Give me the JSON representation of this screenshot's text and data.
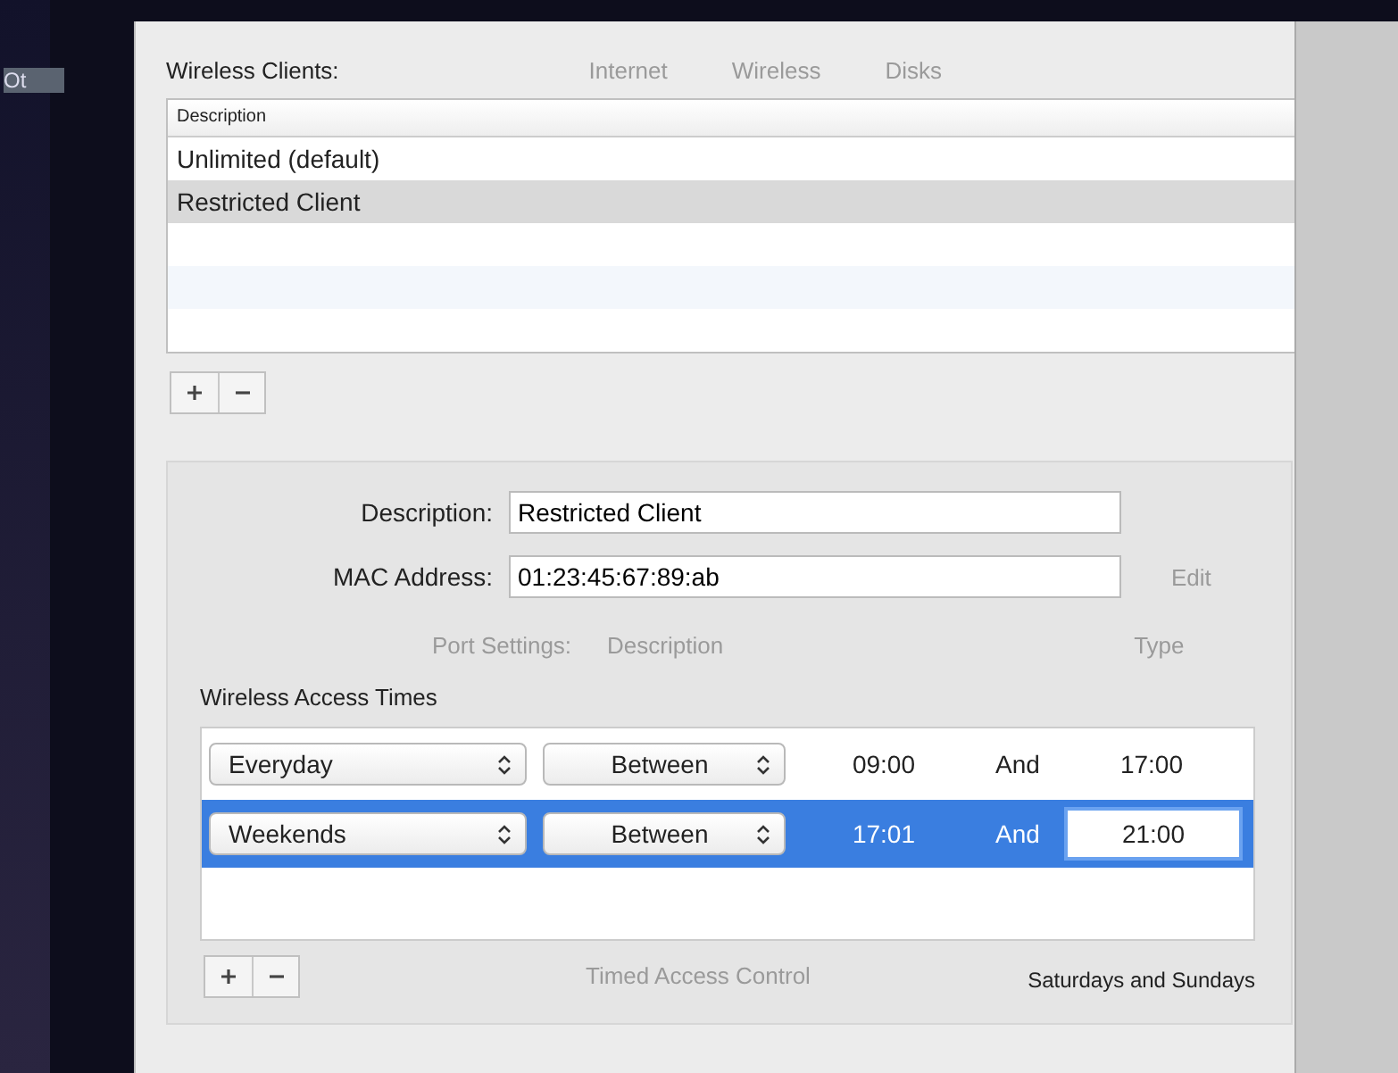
{
  "background": {
    "sidebar_text": "Ot",
    "tabs": [
      {
        "label": "Internet"
      },
      {
        "label": "Wireless"
      },
      {
        "label": "Disks"
      }
    ],
    "port_settings": {
      "label": "Port Settings:",
      "column_1": "Description",
      "column_2": "Type"
    },
    "edit_button": "Edit",
    "timed_access_control": "Timed Access Control"
  },
  "clients": {
    "label": "Wireless Clients:",
    "column": "Description",
    "rows": [
      {
        "name": "Unlimited (default)",
        "selected": false
      },
      {
        "name": "Restricted Client",
        "selected": true
      }
    ]
  },
  "details": {
    "description_label": "Description:",
    "description_value": "Restricted Client",
    "mac_label": "MAC Address:",
    "mac_value": "01:23:45:67:89:ab"
  },
  "access_times": {
    "label": "Wireless Access Times",
    "rows": [
      {
        "days": "Everyday",
        "mode": "Between",
        "start": "09:00",
        "and": "And",
        "end": "17:00",
        "selected": false,
        "editing": false
      },
      {
        "days": "Weekends",
        "mode": "Between",
        "start": "17:01",
        "and": "And",
        "end": "21:00",
        "selected": true,
        "editing": true
      }
    ],
    "summary": "Saturdays and Sundays"
  }
}
